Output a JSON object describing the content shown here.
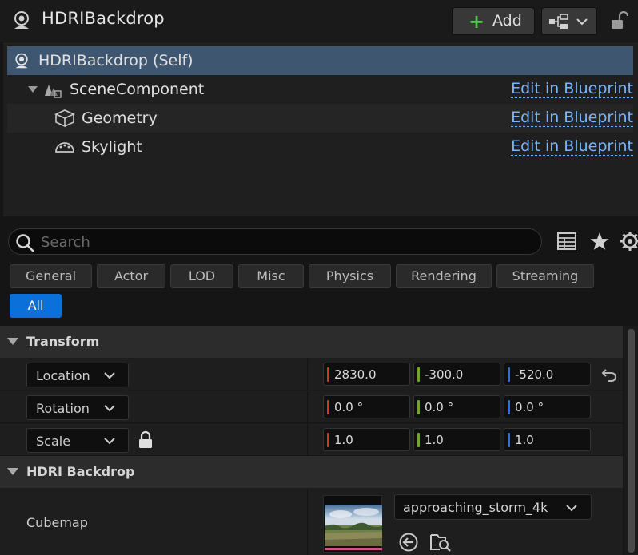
{
  "header": {
    "title": "HDRIBackdrop",
    "add_label": "Add"
  },
  "tree": {
    "rows": [
      {
        "label": "HDRIBackdrop (Self)"
      },
      {
        "label": "SceneComponent",
        "action": "Edit in Blueprint"
      },
      {
        "label": "Geometry",
        "action": "Edit in Blueprint"
      },
      {
        "label": "Skylight",
        "action": "Edit in Blueprint"
      }
    ]
  },
  "search": {
    "placeholder": "Search"
  },
  "filters": [
    "General",
    "Actor",
    "LOD",
    "Misc",
    "Physics",
    "Rendering",
    "Streaming",
    "All"
  ],
  "active_filter": "All",
  "transform": {
    "title": "Transform",
    "location": {
      "label": "Location",
      "x": "2830.0",
      "y": "-300.0",
      "z": "-520.0"
    },
    "rotation": {
      "label": "Rotation",
      "x": "0.0 °",
      "y": "0.0 °",
      "z": "0.0 °"
    },
    "scale": {
      "label": "Scale",
      "x": "1.0",
      "y": "1.0",
      "z": "1.0"
    }
  },
  "hdri": {
    "title": "HDRI Backdrop",
    "cubemap_label": "Cubemap",
    "cubemap_value": "approaching_storm_4k"
  },
  "colors": {
    "accent": "#0b70d9",
    "selected": "#3f5671",
    "link": "#78b6ff",
    "axis_x": "#d0381c",
    "axis_y": "#6ea82a",
    "axis_z": "#2f6fe0"
  },
  "icons": [
    "actor-icon",
    "plus-icon",
    "blueprint-icon",
    "lock-icon",
    "scene-component-icon",
    "geometry-icon",
    "skylight-icon",
    "search-icon",
    "table-icon",
    "star-icon",
    "gear-icon",
    "reset-icon",
    "use-selected-icon",
    "browse-icon"
  ]
}
